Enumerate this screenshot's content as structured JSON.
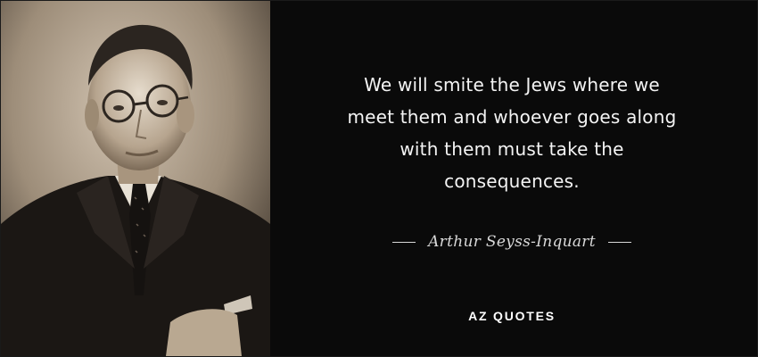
{
  "quote": {
    "lines": [
      "We will smite the Jews where we",
      "meet them and whoever goes along",
      "with them must take the",
      "consequences."
    ]
  },
  "author": {
    "name": "Arthur Seyss-Inquart"
  },
  "brand": {
    "logo_text": "AZ QUOTES"
  },
  "colors": {
    "background": "#0a0a0a",
    "quote_text": "#f4f4f4",
    "author_text": "#d9d9d9"
  },
  "photo": {
    "description_icon": "portrait-photo"
  }
}
